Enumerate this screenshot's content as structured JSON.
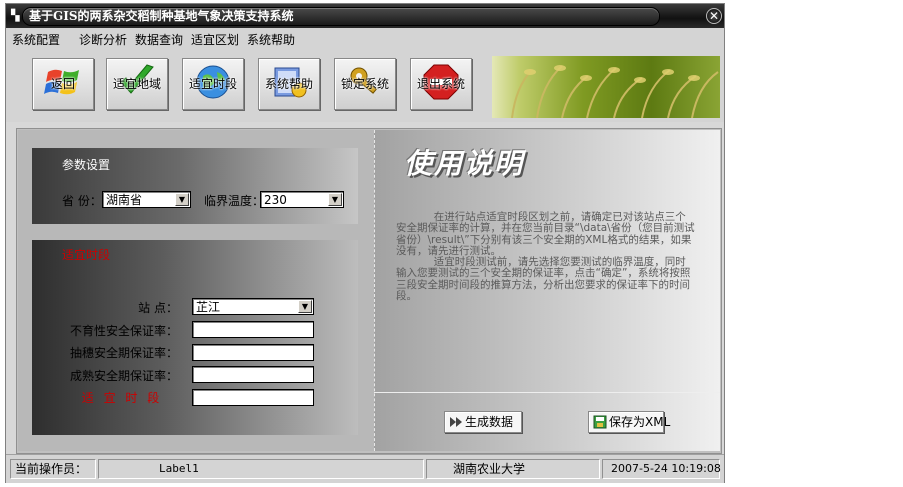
{
  "window": {
    "title": "基于GIS的两系杂交稻制种基地气象决策支持系统",
    "close_glyph": "✕"
  },
  "menu": [
    "系统配置",
    "诊断分析",
    "数据查询",
    "适宜区划",
    "系统帮助"
  ],
  "toolbar": [
    {
      "label": "返回",
      "icon": "windows-logo-icon"
    },
    {
      "label": "适宜地域",
      "icon": "checkmark-icon"
    },
    {
      "label": "适宜时段",
      "icon": "globe-icon"
    },
    {
      "label": "系统帮助",
      "icon": "help-book-icon"
    },
    {
      "label": "锁定系统",
      "icon": "lock-key-icon"
    },
    {
      "label": "退出系统",
      "icon": "stop-sign-icon"
    }
  ],
  "params": {
    "title": "参数设置",
    "province_label": "省 份：",
    "province_value": "湖南省",
    "temp_label": "临界温度：",
    "temp_value": "230"
  },
  "time_section": {
    "title": "适宜时段",
    "station_label": "站    点：",
    "station_value": "芷江",
    "sterility_label": "不育性安全保证率：",
    "heading_label": "抽穗安全期保证率：",
    "maturity_label": "成熟安全期保证率：",
    "suitable_label": "适  宜  时  段"
  },
  "usage": {
    "title": "使用说明",
    "para1": "在进行站点适宜时段区划之前，请确定已对该站点三个安全期保证率的计算，并在您当前目录“\\data\\省份（您目前测试省份）\\result\\”下分别有该三个安全期的XML格式的结果，如果没有，请先进行测试。",
    "para2": "适宜时段测试前，请先选择您要测试的临界温度，同时输入您要测试的三个安全期的保证率，点击“确定”，系统将按照三段安全期时间段的推算方法，分析出您要求的保证率下的时间段。"
  },
  "buttons": {
    "generate": "生成数据",
    "save_xml": "保存为XML"
  },
  "status": {
    "operator_label": "当前操作员：",
    "operator_value": "Label1",
    "org": "湖南农业大学",
    "datetime": "2007-5-24  10:19:08"
  }
}
